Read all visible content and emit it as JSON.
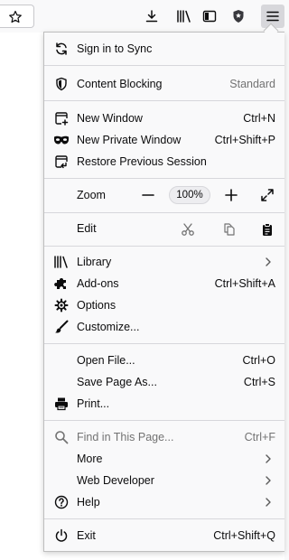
{
  "toolbar": {
    "icons": [
      "star-icon",
      "download-icon",
      "library-icon",
      "sidebar-icon",
      "tracking-shield-icon",
      "hamburger-menu-icon"
    ]
  },
  "menu": {
    "sync": {
      "label": "Sign in to Sync",
      "icon": "sync-icon"
    },
    "content_blocking": {
      "label": "Content Blocking",
      "value": "Standard",
      "icon": "shield-icon"
    },
    "new_window": {
      "label": "New Window",
      "shortcut": "Ctrl+N",
      "icon": "new-window-icon"
    },
    "new_private_window": {
      "label": "New Private Window",
      "shortcut": "Ctrl+Shift+P",
      "icon": "private-mask-icon"
    },
    "restore_session": {
      "label": "Restore Previous Session",
      "icon": "restore-session-icon"
    },
    "zoom": {
      "label": "Zoom",
      "value": "100%",
      "minus": "−",
      "plus": "+",
      "icons": [
        "zoom-out-icon",
        "zoom-in-icon",
        "fullscreen-icon"
      ]
    },
    "edit": {
      "label": "Edit",
      "icons": [
        "cut-icon",
        "copy-icon",
        "paste-icon"
      ]
    },
    "library": {
      "label": "Library",
      "icon": "library-icon"
    },
    "addons": {
      "label": "Add-ons",
      "shortcut": "Ctrl+Shift+A",
      "icon": "puzzle-piece-icon"
    },
    "options": {
      "label": "Options",
      "icon": "gear-icon"
    },
    "customize": {
      "label": "Customize...",
      "icon": "paintbrush-icon"
    },
    "open_file": {
      "label": "Open File...",
      "shortcut": "Ctrl+O"
    },
    "save_page": {
      "label": "Save Page As...",
      "shortcut": "Ctrl+S"
    },
    "print": {
      "label": "Print...",
      "icon": "printer-icon"
    },
    "find": {
      "label": "Find in This Page...",
      "shortcut": "Ctrl+F",
      "icon": "search-icon"
    },
    "more": {
      "label": "More"
    },
    "web_developer": {
      "label": "Web Developer"
    },
    "help": {
      "label": "Help",
      "icon": "help-icon"
    },
    "exit": {
      "label": "Exit",
      "shortcut": "Ctrl+Shift+Q",
      "icon": "power-icon"
    }
  },
  "colors": {
    "panel_bg": "#f9f9fa",
    "separator": "#d7d7db",
    "text": "#0c0c0d",
    "dim_text": "#737373",
    "icon": "#0c0c0d"
  }
}
